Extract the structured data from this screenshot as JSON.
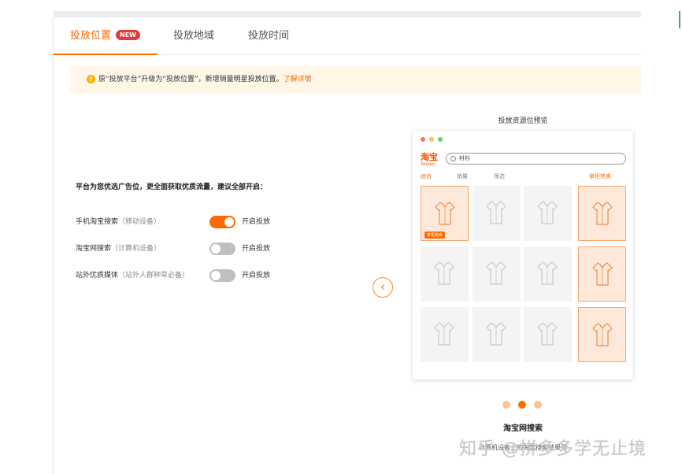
{
  "tabs": [
    {
      "label": "投放位置",
      "badge": "NEW",
      "active": true
    },
    {
      "label": "投放地域",
      "active": false
    },
    {
      "label": "投放时间",
      "active": false
    }
  ],
  "notice": {
    "text": "原“投放平台”升级为“投放位置”，新增销量明星投放位置。",
    "link": "了解详情"
  },
  "settings": {
    "intro": "平台为您优选广告位，更全面获取优质流量，建议全部开启：",
    "rows": [
      {
        "name": "手机淘宝搜索",
        "sub": "（移动设备）",
        "on": true,
        "toggle_label": "开启投放"
      },
      {
        "name": "淘宝网搜索",
        "sub": "（计算机设备）",
        "on": false,
        "toggle_label": "开启投放"
      },
      {
        "name": "站外优质媒体",
        "sub": "（站外人群种草必备）",
        "on": false,
        "toggle_label": "开启投放"
      }
    ]
  },
  "preview": {
    "title": "投放资源位预览",
    "logo": "淘宝",
    "logo_sub": "Taobao",
    "search_value": "衬衫",
    "sort_tabs": [
      "综合",
      "销量",
      "筛选"
    ],
    "hot_label": "掌柜热卖",
    "tag_label": "掌柜热卖",
    "window_dot_colors": [
      "#ff6b6b",
      "#ffc04d",
      "#5cd65c"
    ],
    "caption": "淘宝网搜索",
    "caption_desc": "计算机设备上的淘宝搜索结果页",
    "current_slide": 2,
    "slide_count": 3
  },
  "watermark": "知乎 @拼多多学无止境",
  "colors": {
    "accent": "#ff6a00",
    "badge": "#e4393c",
    "notice_bg": "#fff6e8"
  },
  "icons": {
    "notice": "warning-icon",
    "prev": "chevron-left-icon",
    "search": "search-icon",
    "product": "shirt-icon"
  }
}
